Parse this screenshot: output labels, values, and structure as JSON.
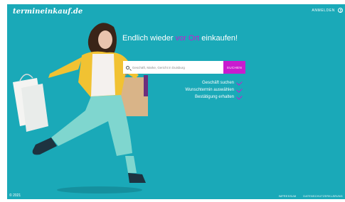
{
  "header": {
    "logo": "termineinkauf.de",
    "login_label": "ANMELDEN"
  },
  "hero": {
    "headline_pre": "Endlich wieder ",
    "headline_accent": "vor Ort",
    "headline_post": " einkaufen!",
    "image_description": "Woman with yellow jacket and turquoise trousers jumping with shopping bags"
  },
  "search": {
    "placeholder": "Geschäft, Marke, Gericht in Duisburg",
    "button_label": "SUCHEN"
  },
  "steps": [
    {
      "label": "Geschäft suchen"
    },
    {
      "label": "Wunschtermin auswählen"
    },
    {
      "label": "Bestätigung erhalten"
    }
  ],
  "footer": {
    "copyright": "© 2021",
    "links": [
      "IMPRESSUM",
      "DATENSCHUTZERKLÄRUNG"
    ]
  },
  "colors": {
    "background": "#1aa9b8",
    "accent": "#c81ccf",
    "text": "#ffffff"
  },
  "icons": [
    "search-icon",
    "user-icon",
    "check-icon"
  ]
}
